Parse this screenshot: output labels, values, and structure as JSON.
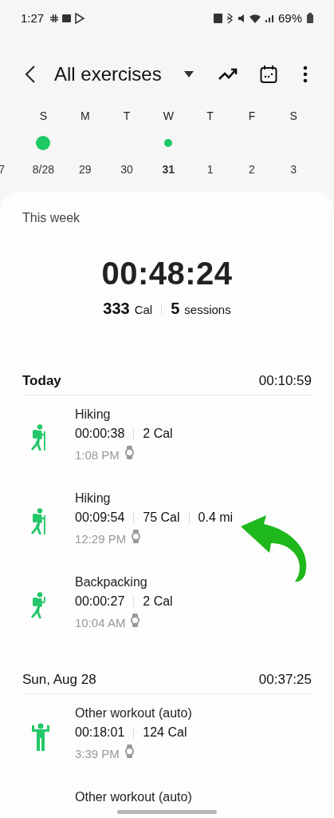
{
  "status_bar": {
    "time": "1:27",
    "battery": "69%"
  },
  "header": {
    "title": "All exercises"
  },
  "calendar": {
    "previous_date": "7",
    "days": [
      {
        "weekday": "S",
        "date": "8/28",
        "has_activity": true,
        "dot_large": true,
        "selected": false
      },
      {
        "weekday": "M",
        "date": "29",
        "selected": false
      },
      {
        "weekday": "T",
        "date": "30",
        "selected": false
      },
      {
        "weekday": "W",
        "date": "31",
        "has_activity": true,
        "dot_large": false,
        "selected": true
      },
      {
        "weekday": "T",
        "date": "1",
        "selected": false
      },
      {
        "weekday": "F",
        "date": "2",
        "selected": false
      },
      {
        "weekday": "S",
        "date": "3",
        "selected": false
      }
    ]
  },
  "summary": {
    "label": "This week",
    "duration": "00:48:24",
    "calories": "333",
    "calories_unit": "Cal",
    "sessions": "5",
    "sessions_unit": "sessions"
  },
  "groups": [
    {
      "title": "Today",
      "total": "00:10:59",
      "sessions": [
        {
          "kind": "hiking",
          "name": "Hiking",
          "stats": [
            "00:00:38",
            "2 Cal"
          ],
          "time": "1:08 PM"
        },
        {
          "kind": "hiking",
          "name": "Hiking",
          "stats": [
            "00:09:54",
            "75 Cal",
            "0.4 mi"
          ],
          "time": "12:29 PM"
        },
        {
          "kind": "backpacking",
          "name": "Backpacking",
          "stats": [
            "00:00:27",
            "2 Cal"
          ],
          "time": "10:04 AM"
        }
      ]
    },
    {
      "title": "Sun, Aug 28",
      "total": "00:37:25",
      "sessions": [
        {
          "kind": "workout",
          "name": "Other workout (auto)",
          "stats": [
            "00:18:01",
            "124 Cal"
          ],
          "time": "3:39 PM"
        },
        {
          "name": "Other workout (auto)"
        }
      ]
    }
  ]
}
